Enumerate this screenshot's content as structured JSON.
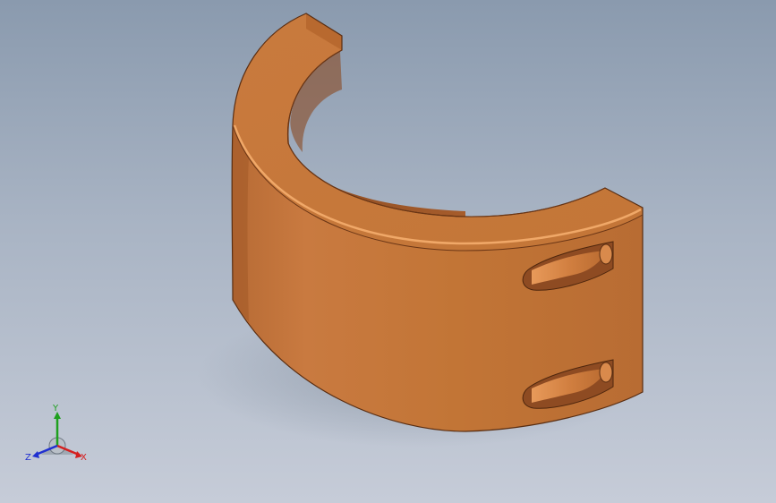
{
  "viewport": {
    "background_top": "#8a9aae",
    "background_bottom": "#c6ccd8"
  },
  "model": {
    "part": "half-ring clamp",
    "color_main": "#c0733a",
    "color_light": "#d6884a",
    "color_dark": "#9a5527",
    "hole_count": 2
  },
  "triad": {
    "x_label": "X",
    "y_label": "Y",
    "z_label": "Z",
    "x_color": "#d42020",
    "y_color": "#1ea01e",
    "z_color": "#2030d0"
  }
}
